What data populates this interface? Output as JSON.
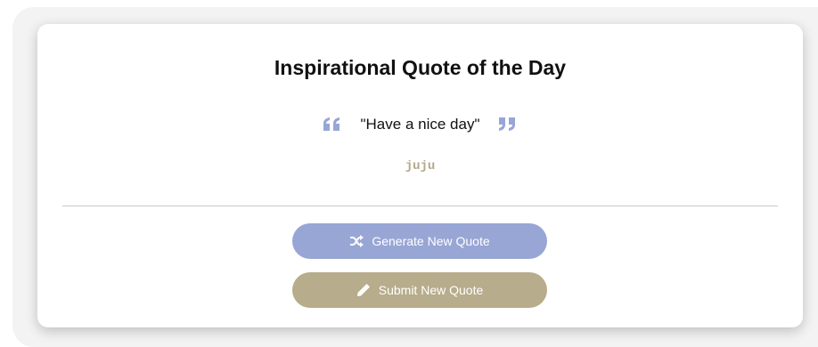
{
  "title": "Inspirational Quote of the Day",
  "quote": {
    "text": "\"Have a nice day\"",
    "author": "juju",
    "open_icon": "quote-left-icon",
    "close_icon": "quote-right-icon"
  },
  "buttons": {
    "generate_label": "Generate New Quote",
    "generate_icon": "shuffle-icon",
    "submit_label": "Submit New Quote",
    "submit_icon": "pencil-icon"
  },
  "colors": {
    "accent_blue": "#98a6d5",
    "accent_tan": "#b7ac8b",
    "author_text": "#b4a888"
  }
}
